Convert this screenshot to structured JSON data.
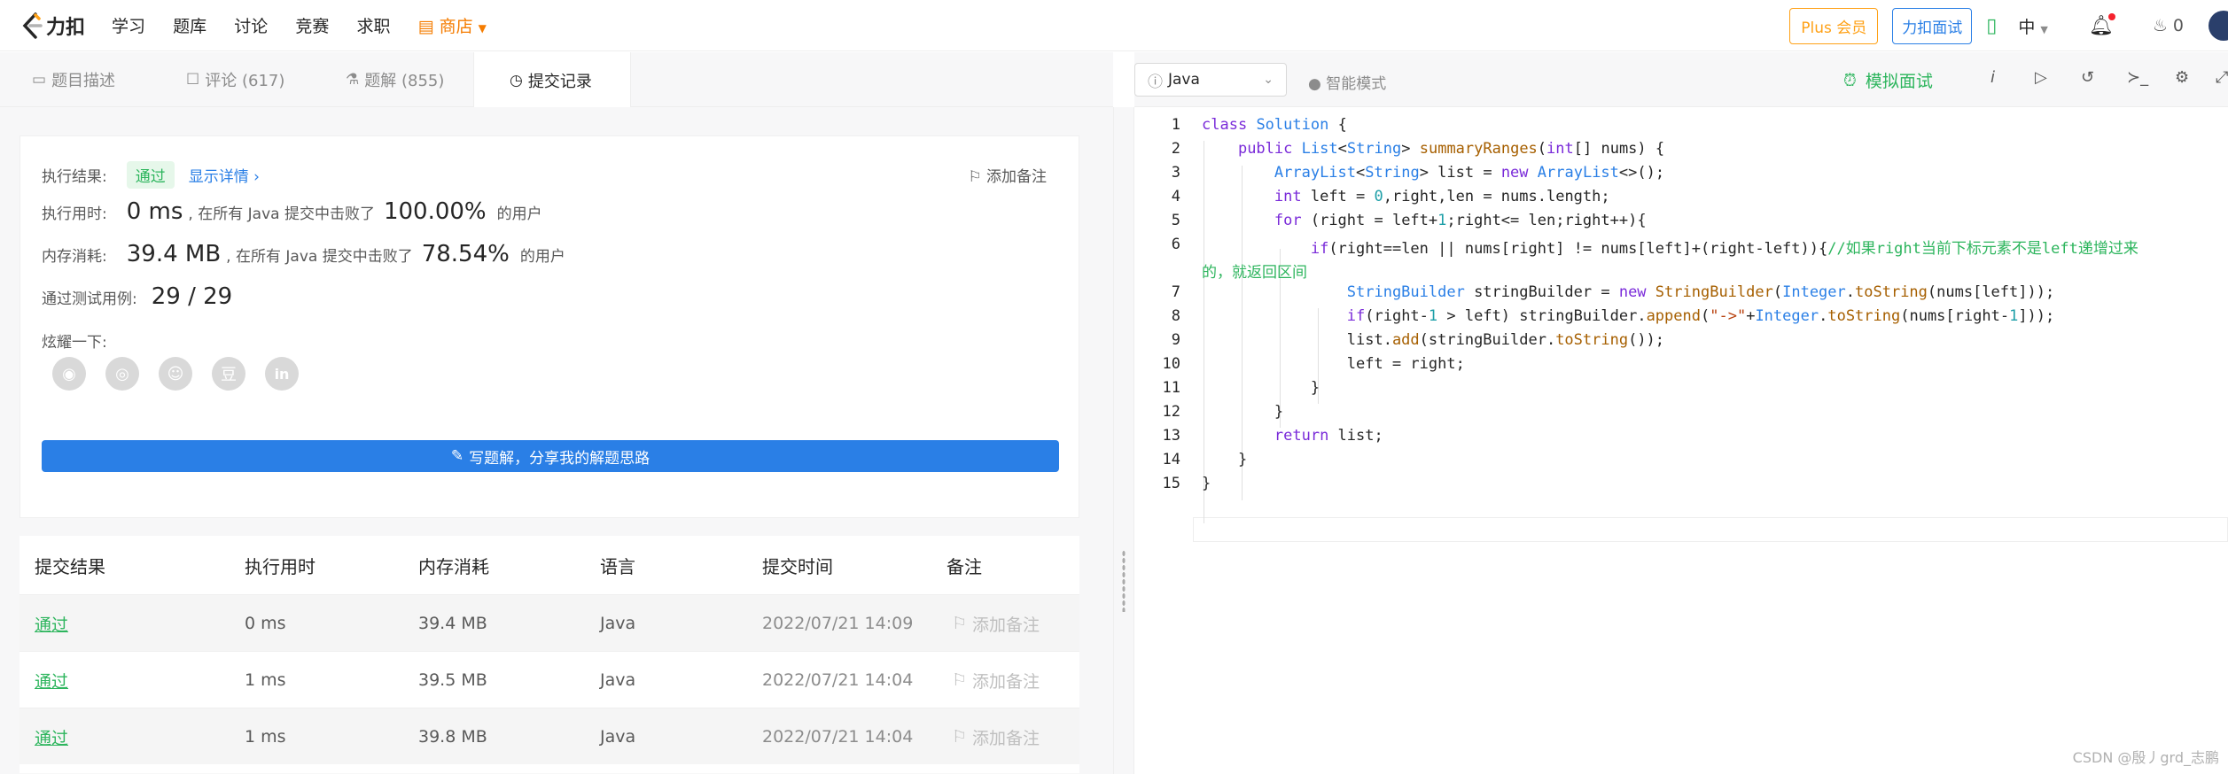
{
  "header": {
    "logo_text": "力扣",
    "nav": [
      "学习",
      "题库",
      "讨论",
      "竞赛",
      "求职"
    ],
    "shop": "商店",
    "plus": "Plus 会员",
    "leetcode_test": "力扣面试",
    "lang": "中",
    "points": "0"
  },
  "tabs": [
    {
      "label": "题目描述",
      "icon": "description-icon"
    },
    {
      "label": "评论 (617)",
      "icon": "comment-icon"
    },
    {
      "label": "题解 (855)",
      "icon": "flask-icon"
    },
    {
      "label": "提交记录",
      "icon": "clock-icon"
    }
  ],
  "result": {
    "status_label": "执行结果:",
    "status": "通过",
    "detail": "显示详情 ›",
    "add_note": "添加备注",
    "time_label": "执行用时:",
    "time": "0 ms",
    "time_mid": ", 在所有 Java 提交中击败了",
    "time_pct": "100.00%",
    "users": "的用户",
    "mem_label": "内存消耗:",
    "mem": "39.4 MB",
    "mem_mid": ", 在所有 Java 提交中击败了",
    "mem_pct": "78.54%",
    "cases_label": "通过测试用例:",
    "cases": "29 / 29",
    "share_label": "炫耀一下:",
    "write_button": "写题解，分享我的解题思路"
  },
  "table": {
    "headers": [
      "提交结果",
      "执行用时",
      "内存消耗",
      "语言",
      "提交时间",
      "备注"
    ],
    "rows": [
      {
        "result": "通过",
        "time": "0 ms",
        "memory": "39.4 MB",
        "lang": "Java",
        "submitted": "2022/07/21 14:09",
        "note": "添加备注"
      },
      {
        "result": "通过",
        "time": "1 ms",
        "memory": "39.5 MB",
        "lang": "Java",
        "submitted": "2022/07/21 14:04",
        "note": "添加备注"
      },
      {
        "result": "通过",
        "time": "1 ms",
        "memory": "39.8 MB",
        "lang": "Java",
        "submitted": "2022/07/21 14:04",
        "note": "添加备注"
      }
    ]
  },
  "editor": {
    "language": "Java",
    "smart_mode": "智能模式",
    "mock": "模拟面试",
    "line_numbers": [
      "1",
      "2",
      "3",
      "4",
      "5",
      "6",
      "",
      "7",
      "8",
      "9",
      "10",
      "11",
      "12",
      "13",
      "14",
      "15"
    ]
  },
  "watermark": "CSDN @殷丿grd_志鹏",
  "colors": {
    "accent": "#2a7fe6",
    "success": "#2db55d",
    "plus": "#ffa116",
    "shop": "#f57c00"
  }
}
